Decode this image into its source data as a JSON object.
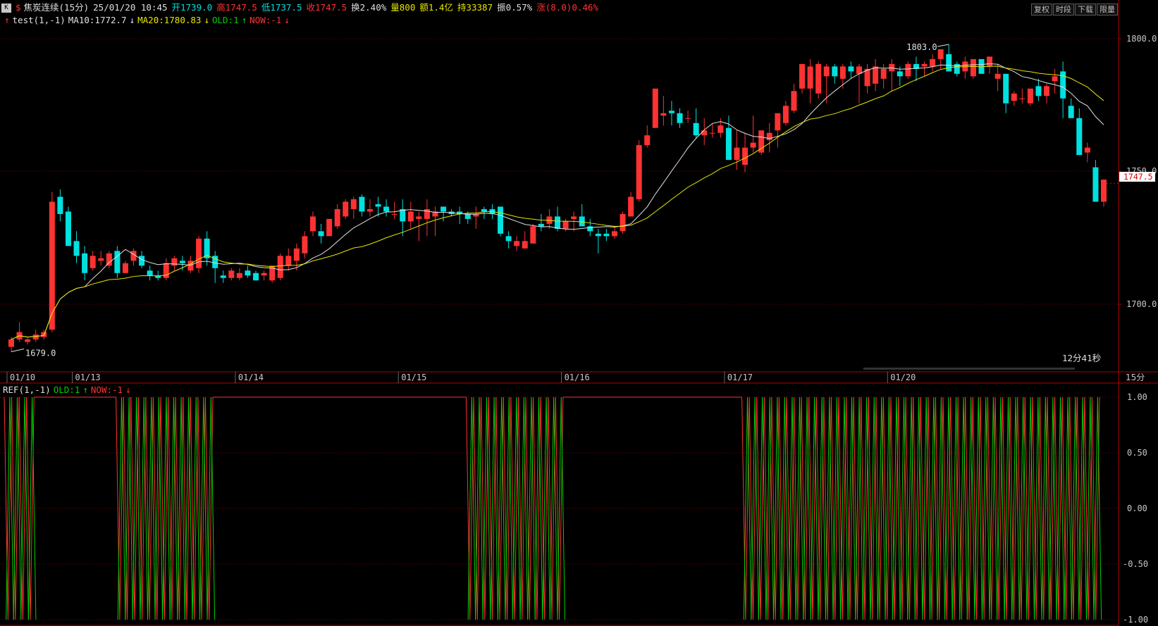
{
  "header": {
    "k_icon": "K",
    "s_icon": "$",
    "title": "焦炭连续(15分)",
    "datetime": "25/01/20 10:45",
    "open": "开1739.0",
    "high": "高1747.5",
    "low": "低1737.5",
    "close": "收1747.5",
    "turnover": "换2.40%",
    "volume": "量800",
    "amount": "额1.4亿",
    "hold": "持33387",
    "amplitude": "振0.57%",
    "change": "涨(8.0)0.46%"
  },
  "toolbar": {
    "reset": "复权",
    "interval": "时段",
    "download": "下载",
    "limit": "限量"
  },
  "main_indicator": {
    "name": "test(1,-1)",
    "ma10": "MA10:1772.7",
    "ma20": "MA20:1780.83",
    "old": "OLD:1",
    "now": "NOW:-1"
  },
  "sub_indicator": {
    "name": "REF(1,-1)",
    "old": "OLD:1",
    "now": "NOW:-1"
  },
  "labels": {
    "max": "1803.0",
    "min": "1679.0",
    "current_price": "1747.5",
    "countdown": "12分41秒",
    "period": "15分"
  },
  "colors": {
    "up": "#ff3232",
    "down": "#00e0e0",
    "ma10": "#e0e0e0",
    "ma20": "#e6e600",
    "grid": "#8b0000",
    "border": "#b40000"
  },
  "chart_data": {
    "type": "candlestick",
    "y_axis_ticks": [
      "1800.0",
      "1750.0",
      "1700.0"
    ],
    "y_range": [
      1676,
      1810
    ],
    "date_labels": [
      {
        "label": "01/10",
        "index": 0
      },
      {
        "label": "01/13",
        "index": 8
      },
      {
        "label": "01/14",
        "index": 28
      },
      {
        "label": "01/15",
        "index": 48
      },
      {
        "label": "01/16",
        "index": 68
      },
      {
        "label": "01/17",
        "index": 88
      },
      {
        "label": "01/20",
        "index": 108
      }
    ],
    "candles": [
      [
        1681,
        1685,
        1679,
        1684
      ],
      [
        1684,
        1691,
        1683,
        1687
      ],
      [
        1683,
        1685,
        1682,
        1684
      ],
      [
        1684,
        1688,
        1683,
        1686
      ],
      [
        1685,
        1688,
        1684,
        1687
      ],
      [
        1688,
        1744,
        1687,
        1740
      ],
      [
        1742,
        1745,
        1732,
        1735
      ],
      [
        1736,
        1738,
        1722,
        1722
      ],
      [
        1724,
        1728,
        1715,
        1718
      ],
      [
        1719,
        1722,
        1708,
        1711
      ],
      [
        1713,
        1720,
        1712,
        1718
      ],
      [
        1716,
        1720,
        1714,
        1717
      ],
      [
        1714,
        1720,
        1713,
        1719
      ],
      [
        1720,
        1722,
        1709,
        1711
      ],
      [
        1711,
        1716,
        1711,
        1715
      ],
      [
        1716,
        1721,
        1714,
        1720
      ],
      [
        1718,
        1720,
        1713,
        1714
      ],
      [
        1712,
        1714,
        1708,
        1710
      ],
      [
        1710,
        1712,
        1708,
        1709
      ],
      [
        1709,
        1717,
        1708,
        1715
      ],
      [
        1714,
        1718,
        1712,
        1717
      ],
      [
        1716,
        1718,
        1712,
        1715
      ],
      [
        1712,
        1718,
        1711,
        1716
      ],
      [
        1713,
        1726,
        1711,
        1725
      ],
      [
        1725,
        1728,
        1714,
        1717
      ],
      [
        1718,
        1720,
        1707,
        1713
      ],
      [
        1710,
        1712,
        1707,
        1709
      ],
      [
        1709,
        1713,
        1708,
        1712
      ],
      [
        1709,
        1713,
        1708,
        1711
      ],
      [
        1712,
        1714,
        1709,
        1710
      ],
      [
        1711,
        1712,
        1708,
        1708
      ],
      [
        1710,
        1712,
        1708,
        1711
      ],
      [
        1708,
        1714,
        1707,
        1714
      ],
      [
        1709,
        1719,
        1708,
        1718
      ],
      [
        1714,
        1721,
        1712,
        1718
      ],
      [
        1716,
        1723,
        1712,
        1721
      ],
      [
        1719,
        1728,
        1717,
        1726
      ],
      [
        1728,
        1736,
        1726,
        1734
      ],
      [
        1728,
        1731,
        1723,
        1726
      ],
      [
        1726,
        1733,
        1726,
        1733
      ],
      [
        1730,
        1739,
        1729,
        1737
      ],
      [
        1734,
        1741,
        1733,
        1740
      ],
      [
        1737,
        1742,
        1733,
        1741
      ],
      [
        1742,
        1743,
        1734,
        1736
      ],
      [
        1736,
        1741,
        1734,
        1737
      ],
      [
        1739,
        1742,
        1734,
        1738
      ],
      [
        1738,
        1741,
        1734,
        1736
      ],
      [
        1735,
        1740,
        1733,
        1735
      ],
      [
        1737,
        1741,
        1726,
        1732
      ],
      [
        1732,
        1740,
        1729,
        1736
      ],
      [
        1733,
        1736,
        1724,
        1734
      ],
      [
        1733,
        1741,
        1726,
        1737
      ],
      [
        1734,
        1738,
        1726,
        1736
      ],
      [
        1738,
        1738,
        1732,
        1736
      ],
      [
        1736,
        1737,
        1734,
        1735
      ],
      [
        1736,
        1738,
        1731,
        1735
      ],
      [
        1735,
        1736,
        1731,
        1733
      ],
      [
        1734,
        1738,
        1729,
        1735
      ],
      [
        1737,
        1738,
        1733,
        1736
      ],
      [
        1737,
        1739,
        1733,
        1735
      ],
      [
        1738,
        1738,
        1726,
        1727
      ],
      [
        1726,
        1728,
        1721,
        1724
      ],
      [
        1722,
        1726,
        1720,
        1724
      ],
      [
        1721,
        1728,
        1721,
        1724
      ],
      [
        1723,
        1731,
        1723,
        1730
      ],
      [
        1731,
        1735,
        1728,
        1730
      ],
      [
        1731,
        1737,
        1729,
        1734
      ],
      [
        1734,
        1738,
        1728,
        1729
      ],
      [
        1729,
        1733,
        1728,
        1732
      ],
      [
        1733,
        1736,
        1728,
        1734
      ],
      [
        1734,
        1739,
        1730,
        1730
      ],
      [
        1730,
        1733,
        1726,
        1728
      ],
      [
        1727,
        1729,
        1719,
        1726
      ],
      [
        1727,
        1729,
        1724,
        1726
      ],
      [
        1726,
        1730,
        1725,
        1728
      ],
      [
        1728,
        1736,
        1727,
        1735
      ],
      [
        1734,
        1744,
        1734,
        1742
      ],
      [
        1741,
        1765,
        1740,
        1763
      ],
      [
        1763,
        1771,
        1762,
        1767
      ],
      [
        1770,
        1784,
        1770,
        1786
      ],
      [
        1775,
        1783,
        1771,
        1776
      ],
      [
        1777,
        1781,
        1771,
        1776
      ],
      [
        1776,
        1778,
        1770,
        1772
      ],
      [
        1774,
        1777,
        1772,
        1774
      ],
      [
        1772,
        1778,
        1766,
        1767
      ],
      [
        1767,
        1774,
        1763,
        1769
      ],
      [
        1768,
        1772,
        1766,
        1768
      ],
      [
        1768,
        1774,
        1766,
        1771
      ],
      [
        1770,
        1775,
        1757,
        1757
      ],
      [
        1757,
        1769,
        1753,
        1762
      ],
      [
        1755,
        1768,
        1752,
        1762
      ],
      [
        1762,
        1775,
        1760,
        1764
      ],
      [
        1760,
        1768,
        1759,
        1769
      ],
      [
        1765,
        1772,
        1760,
        1768
      ],
      [
        1769,
        1775,
        1762,
        1776
      ],
      [
        1772,
        1781,
        1771,
        1779
      ],
      [
        1777,
        1788,
        1776,
        1785
      ],
      [
        1786,
        1793,
        1784,
        1796
      ],
      [
        1786,
        1798,
        1780,
        1795
      ],
      [
        1784,
        1797,
        1782,
        1796
      ],
      [
        1791,
        1796,
        1780,
        1795
      ],
      [
        1795,
        1796,
        1788,
        1791
      ],
      [
        1790,
        1796,
        1786,
        1795
      ],
      [
        1795,
        1797,
        1790,
        1793
      ],
      [
        1792,
        1796,
        1780,
        1795
      ],
      [
        1787,
        1796,
        1784,
        1794
      ],
      [
        1788,
        1798,
        1785,
        1795
      ],
      [
        1790,
        1796,
        1786,
        1794
      ],
      [
        1793,
        1798,
        1785,
        1796
      ],
      [
        1793,
        1795,
        1787,
        1791
      ],
      [
        1791,
        1797,
        1790,
        1796
      ],
      [
        1796,
        1799,
        1789,
        1794
      ],
      [
        1795,
        1797,
        1791,
        1796
      ],
      [
        1795,
        1800,
        1793,
        1798
      ],
      [
        1798,
        1801,
        1794,
        1802
      ],
      [
        1800,
        1804,
        1793,
        1793
      ],
      [
        1796,
        1797,
        1791,
        1792
      ],
      [
        1793,
        1799,
        1790,
        1797
      ],
      [
        1791,
        1797,
        1790,
        1798
      ],
      [
        1798,
        1797,
        1792,
        1792
      ],
      [
        1795,
        1799,
        1792,
        1799
      ],
      [
        1790,
        1796,
        1785,
        1792
      ],
      [
        1792,
        1792,
        1776,
        1780
      ],
      [
        1781,
        1785,
        1779,
        1784
      ],
      [
        1782,
        1786,
        1780,
        1782
      ],
      [
        1780,
        1785,
        1779,
        1786
      ],
      [
        1787,
        1790,
        1781,
        1783
      ],
      [
        1783,
        1788,
        1780,
        1787
      ],
      [
        1789,
        1794,
        1784,
        1791
      ],
      [
        1793,
        1797,
        1774,
        1782
      ],
      [
        1779,
        1782,
        1776,
        1774
      ],
      [
        1774,
        1778,
        1759,
        1759
      ],
      [
        1760,
        1764,
        1756,
        1762
      ],
      [
        1754,
        1757,
        1740,
        1740
      ],
      [
        1740,
        1749,
        1738,
        1749
      ]
    ]
  }
}
